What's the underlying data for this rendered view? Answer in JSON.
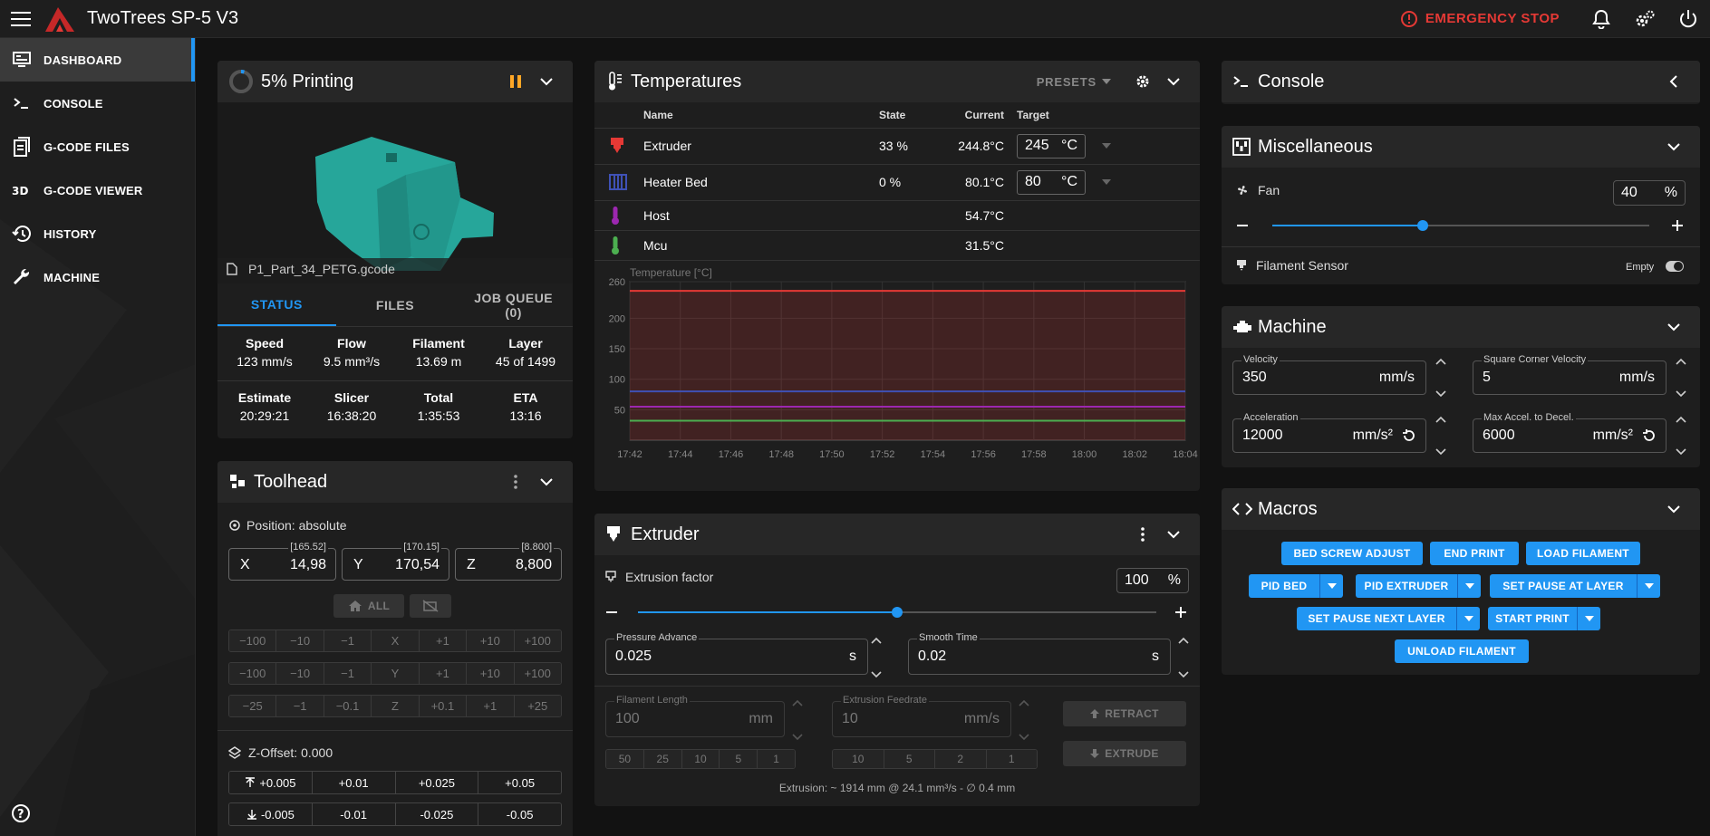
{
  "app": {
    "title": "TwoTrees SP-5 V3",
    "emergency_label": "EMERGENCY STOP",
    "accent_color": "#2196f3",
    "danger_color": "#e53935"
  },
  "nav": [
    {
      "label": "DASHBOARD",
      "icon": "monitor-dashboard-icon",
      "active": true
    },
    {
      "label": "CONSOLE",
      "icon": "console-icon"
    },
    {
      "label": "G-CODE FILES",
      "icon": "file-document-icon"
    },
    {
      "label": "G-CODE VIEWER",
      "icon": "3d-icon"
    },
    {
      "label": "HISTORY",
      "icon": "history-icon"
    },
    {
      "label": "MACHINE",
      "icon": "wrench-icon"
    }
  ],
  "status_panel": {
    "title": "5% Printing",
    "progress": 0.05,
    "filename": "P1_Part_34_PETG.gcode",
    "tabs": [
      "STATUS",
      "FILES",
      "JOB QUEUE\n(0)"
    ],
    "stats_row1": [
      {
        "label": "Speed",
        "value": "123 mm/s"
      },
      {
        "label": "Flow",
        "value": "9.5 mm³/s"
      },
      {
        "label": "Filament",
        "value": "13.69 m"
      },
      {
        "label": "Layer",
        "value": "45 of 1499"
      }
    ],
    "stats_row2": [
      {
        "label": "Estimate",
        "value": "20:29:21"
      },
      {
        "label": "Slicer",
        "value": "16:38:20"
      },
      {
        "label": "Total",
        "value": "1:35:53"
      },
      {
        "label": "ETA",
        "value": "13:16"
      }
    ]
  },
  "toolhead": {
    "title": "Toolhead",
    "position_label": "Position: absolute",
    "axes": [
      {
        "axis": "X",
        "value": "14,98",
        "requested": "[165.52]"
      },
      {
        "axis": "Y",
        "value": "170,54",
        "requested": "[170.15]"
      },
      {
        "axis": "Z",
        "value": "8,800",
        "requested": "[8.800]"
      }
    ],
    "home_all_label": "ALL",
    "jog_x": [
      "−100",
      "−10",
      "−1",
      "X",
      "+1",
      "+10",
      "+100"
    ],
    "jog_y": [
      "−100",
      "−10",
      "−1",
      "Y",
      "+1",
      "+10",
      "+100"
    ],
    "jog_z": [
      "−25",
      "−1",
      "−0.1",
      "Z",
      "+0.1",
      "+1",
      "+25"
    ],
    "zoffset_label": "Z-Offset: 0.000",
    "zoffset_up": [
      "+0.005",
      "+0.01",
      "+0.025",
      "+0.05"
    ],
    "zoffset_down": [
      "-0.005",
      "-0.01",
      "-0.025",
      "-0.05"
    ]
  },
  "temperatures": {
    "title": "Temperatures",
    "presets_label": "PRESETS",
    "columns": [
      "Name",
      "State",
      "Current",
      "Target"
    ],
    "rows": [
      {
        "name": "Extruder",
        "state": "33 %",
        "current": "244.8°C",
        "target": "245",
        "unit": "°C",
        "color": "#e53935"
      },
      {
        "name": "Heater Bed",
        "state": "0 %",
        "current": "80.1°C",
        "target": "80",
        "unit": "°C",
        "color": "#3f51b5"
      },
      {
        "name": "Host",
        "state": "",
        "current": "54.7°C",
        "target": "",
        "unit": "",
        "color": "#9c27b0"
      },
      {
        "name": "Mcu",
        "state": "",
        "current": "31.5°C",
        "target": "",
        "unit": "",
        "color": "#4caf50"
      }
    ]
  },
  "chart_data": {
    "type": "line",
    "title": "",
    "ylabel": "Temperature [°C]",
    "xlabel": "",
    "ylim": [
      0,
      260
    ],
    "yticks": [
      50,
      100,
      150,
      200,
      260
    ],
    "xticks": [
      "17:42",
      "17:44",
      "17:46",
      "17:48",
      "17:50",
      "17:52",
      "17:54",
      "17:56",
      "17:58",
      "18:00",
      "18:02",
      "18:04"
    ],
    "series": [
      {
        "color": "#e53935",
        "fill": true,
        "values": [
          245,
          245,
          245,
          245,
          245,
          245,
          245,
          245,
          245,
          245,
          245,
          245
        ]
      },
      {
        "color": "#3f51b5",
        "fill": false,
        "values": [
          80,
          80,
          80,
          80,
          80,
          80,
          80,
          80,
          80,
          80,
          80,
          80
        ]
      },
      {
        "color": "#9c27b0",
        "fill": false,
        "values": [
          55,
          55,
          55,
          55,
          55,
          55,
          55,
          55,
          55,
          55,
          55,
          55
        ]
      },
      {
        "color": "#4caf50",
        "fill": false,
        "values": [
          32,
          32,
          32,
          32,
          32,
          32,
          32,
          32,
          32,
          32,
          32,
          32
        ]
      }
    ]
  },
  "extruder": {
    "title": "Extruder",
    "factor_label": "Extrusion factor",
    "factor_value": "100",
    "factor_unit": "%",
    "factor_fraction": 0.5,
    "pressure_advance": {
      "label": "Pressure Advance",
      "value": "0.025",
      "unit": "s"
    },
    "smooth_time": {
      "label": "Smooth Time",
      "value": "0.02",
      "unit": "s"
    },
    "filament_length": {
      "label": "Filament Length",
      "value": "100",
      "unit": "mm"
    },
    "feedrate": {
      "label": "Extrusion Feedrate",
      "value": "10",
      "unit": "mm/s"
    },
    "length_presets": [
      "50",
      "25",
      "10",
      "5",
      "1"
    ],
    "feedrate_presets": [
      "10",
      "5",
      "2",
      "1"
    ],
    "retract_label": "RETRACT",
    "extrude_label": "EXTRUDE",
    "info": "Extrusion: ~ 1914 mm @ 24.1 mm³/s - ∅ 0.4 mm"
  },
  "console": {
    "title": "Console"
  },
  "misc": {
    "title": "Miscellaneous",
    "fan_label": "Fan",
    "fan_value": "40",
    "fan_unit": "%",
    "fan_fraction": 0.4,
    "sensor_label": "Filament Sensor",
    "sensor_state": "Empty"
  },
  "machine": {
    "title": "Machine",
    "velocity": {
      "label": "Velocity",
      "value": "350",
      "unit": "mm/s"
    },
    "scv": {
      "label": "Square Corner Velocity",
      "value": "5",
      "unit": "mm/s"
    },
    "accel": {
      "label": "Acceleration",
      "value": "12000",
      "unit": "mm/s²"
    },
    "decel": {
      "label": "Max Accel. to Decel.",
      "value": "6000",
      "unit": "mm/s²"
    }
  },
  "macros": {
    "title": "Macros",
    "buttons": [
      "BED SCREW ADJUST",
      "END PRINT",
      "LOAD FILAMENT",
      "PID BED",
      "PID EXTRUDER",
      "SET PAUSE AT LAYER",
      "SET PAUSE NEXT LAYER",
      "START PRINT",
      "UNLOAD FILAMENT"
    ]
  }
}
